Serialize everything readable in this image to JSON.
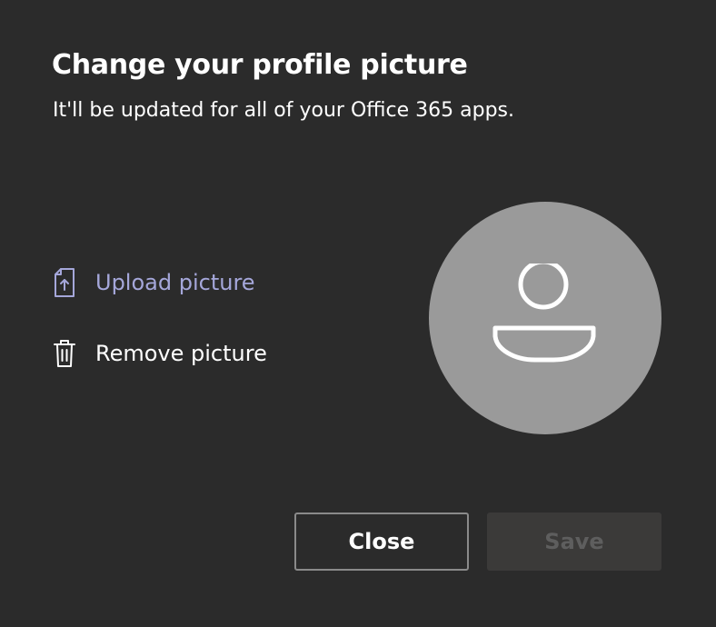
{
  "dialog": {
    "title": "Change your profile picture",
    "subtitle": "It'll be updated for all of your Office 365 apps."
  },
  "actions": {
    "upload": {
      "label": "Upload picture",
      "icon": "upload-file-icon"
    },
    "remove": {
      "label": "Remove picture",
      "icon": "trash-icon"
    }
  },
  "avatar": {
    "icon": "person-placeholder-icon"
  },
  "buttons": {
    "close_label": "Close",
    "save_label": "Save",
    "save_disabled": true
  },
  "colors": {
    "background": "#2b2b2b",
    "link_accent": "#a5a7da",
    "avatar_fill": "#9a9a9a",
    "disabled_button_bg": "#3b3a39",
    "disabled_text": "#5e5e5e"
  }
}
